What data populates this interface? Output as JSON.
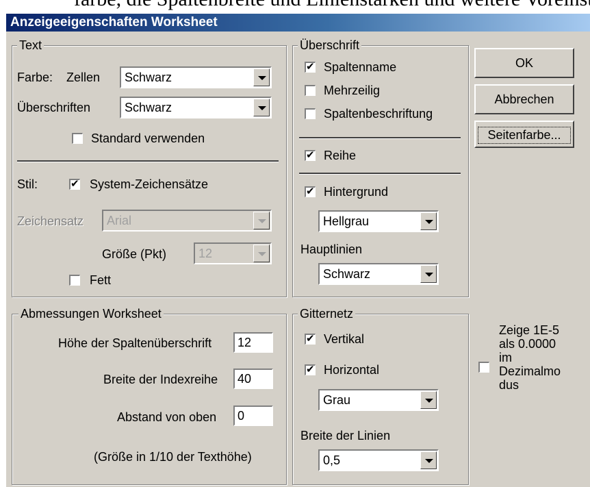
{
  "background_text": "farbe, die Spaltenbreite und Linienstärken und weitere Voreinstellu",
  "window": {
    "title": "Anzeigeeigenschaften Worksheet"
  },
  "text_group": {
    "legend": "Text",
    "farbe_label": "Farbe:",
    "zellen_label": "Zellen",
    "zellen_value": "Schwarz",
    "ueberschriften_label": "Überschriften",
    "ueberschriften_value": "Schwarz",
    "standard_label": "Standard verwenden",
    "standard_checked": false,
    "stil_label": "Stil:",
    "system_label": "System-Zeichensätze",
    "system_checked": true,
    "zeichensatz_label": "Zeichensatz",
    "zeichensatz_value": "Arial",
    "groesse_label": "Größe (Pkt)",
    "groesse_value": "12",
    "fett_label": "Fett",
    "fett_checked": false
  },
  "ueberschrift_group": {
    "legend": "Überschrift",
    "spaltenname_label": "Spaltenname",
    "spaltenname_checked": true,
    "mehrzeilig_label": "Mehrzeilig",
    "mehrzeilig_checked": false,
    "spaltenbeschriftung_label": "Spaltenbeschriftung",
    "spaltenbeschriftung_checked": false,
    "reihe_label": "Reihe",
    "reihe_checked": true,
    "hintergrund_label": "Hintergrund",
    "hintergrund_checked": true,
    "hintergrund_value": "Hellgrau",
    "hauptlinien_label": "Hauptlinien",
    "hauptlinien_value": "Schwarz"
  },
  "buttons": {
    "ok": "OK",
    "abbrechen": "Abbrechen",
    "seitenfarbe": "Seitenfarbe..."
  },
  "abmessungen_group": {
    "legend": "Abmessungen Worksheet",
    "hoehe_label": "Höhe der Spaltenüberschrift",
    "hoehe_value": "12",
    "breite_label": "Breite der Indexreihe",
    "breite_value": "40",
    "abstand_label": "Abstand von oben",
    "abstand_value": "0",
    "note": "(Größe in 1/10 der Texthöhe)"
  },
  "gitternetz_group": {
    "legend": "Gitternetz",
    "vertikal_label": "Vertikal",
    "vertikal_checked": true,
    "horizontal_label": "Horizontal",
    "horizontal_checked": true,
    "farbe_value": "Grau",
    "breite_linien_label": "Breite der Linien",
    "breite_linien_value": "0,5"
  },
  "zeige": {
    "label_line1": "Zeige 1E-5",
    "label_line2": "als 0.0000",
    "label_line3": "im",
    "label_line4": "Dezimalmo",
    "label_line5": "dus",
    "checked": false
  },
  "colors": {
    "dialog_bg": "#d4d0c8",
    "title_start": "#0a246a",
    "title_end": "#a6caf0"
  }
}
